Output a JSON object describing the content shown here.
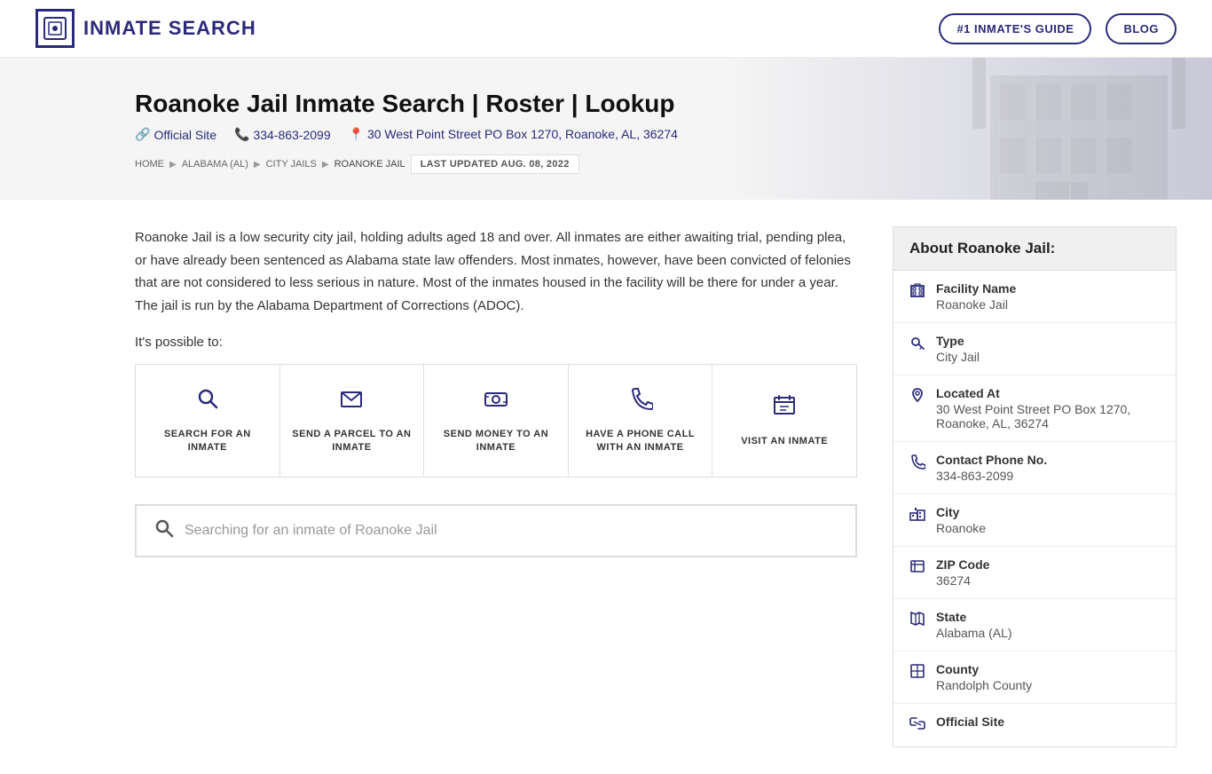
{
  "header": {
    "logo_text": "INMATE SEARCH",
    "nav_guide": "#1 INMATE'S GUIDE",
    "nav_blog": "BLOG"
  },
  "hero": {
    "title": "Roanoke Jail Inmate Search | Roster | Lookup",
    "official_site_label": "Official Site",
    "phone": "334-863-2099",
    "address": "30 West Point Street PO Box 1270, Roanoke, AL, 36274"
  },
  "breadcrumb": {
    "home": "HOME",
    "state": "ALABAMA (AL)",
    "category": "CITY JAILS",
    "current": "ROANOKE JAIL",
    "updated": "LAST UPDATED AUG. 08, 2022"
  },
  "description": {
    "text": "Roanoke Jail is a low security city jail, holding adults aged 18 and over. All inmates are either awaiting trial, pending plea, or have already been sentenced as Alabama state law offenders. Most inmates, however, have been convicted of felonies that are not considered to less serious in nature. Most of the inmates housed in the facility will be there for under a year. The jail is run by the Alabama Department of Corrections (ADOC).",
    "possible": "It's possible to:"
  },
  "action_cards": [
    {
      "id": "search",
      "label": "SEARCH FOR AN INMATE",
      "icon": "🔍"
    },
    {
      "id": "parcel",
      "label": "SEND A PARCEL TO AN INMATE",
      "icon": "✉"
    },
    {
      "id": "money",
      "label": "SEND MONEY TO AN INMATE",
      "icon": "💳"
    },
    {
      "id": "phone",
      "label": "HAVE A PHONE CALL WITH AN INMATE",
      "icon": "📞"
    },
    {
      "id": "visit",
      "label": "VISIT AN INMATE",
      "icon": "📋"
    }
  ],
  "search_bar": {
    "placeholder": "Searching for an inmate of Roanoke Jail"
  },
  "sidebar": {
    "title": "About Roanoke Jail:",
    "items": [
      {
        "id": "facility-name",
        "label": "Facility Name",
        "value": "Roanoke Jail",
        "icon": "🏛"
      },
      {
        "id": "type",
        "label": "Type",
        "value": "City Jail",
        "icon": "🔑"
      },
      {
        "id": "located-at",
        "label": "Located At",
        "value": "30 West Point Street PO Box 1270, Roanoke, AL, 36274",
        "icon": "📍"
      },
      {
        "id": "phone",
        "label": "Contact Phone No.",
        "value": "334-863-2099",
        "icon": "📞"
      },
      {
        "id": "city",
        "label": "City",
        "value": "Roanoke",
        "icon": "🏙"
      },
      {
        "id": "zip",
        "label": "ZIP Code",
        "value": "36274",
        "icon": "📬"
      },
      {
        "id": "state",
        "label": "State",
        "value": "Alabama (AL)",
        "icon": "🗺"
      },
      {
        "id": "county",
        "label": "County",
        "value": "Randolph County",
        "icon": "📐"
      },
      {
        "id": "official-site",
        "label": "Official Site",
        "value": "",
        "icon": "🔗"
      }
    ]
  }
}
